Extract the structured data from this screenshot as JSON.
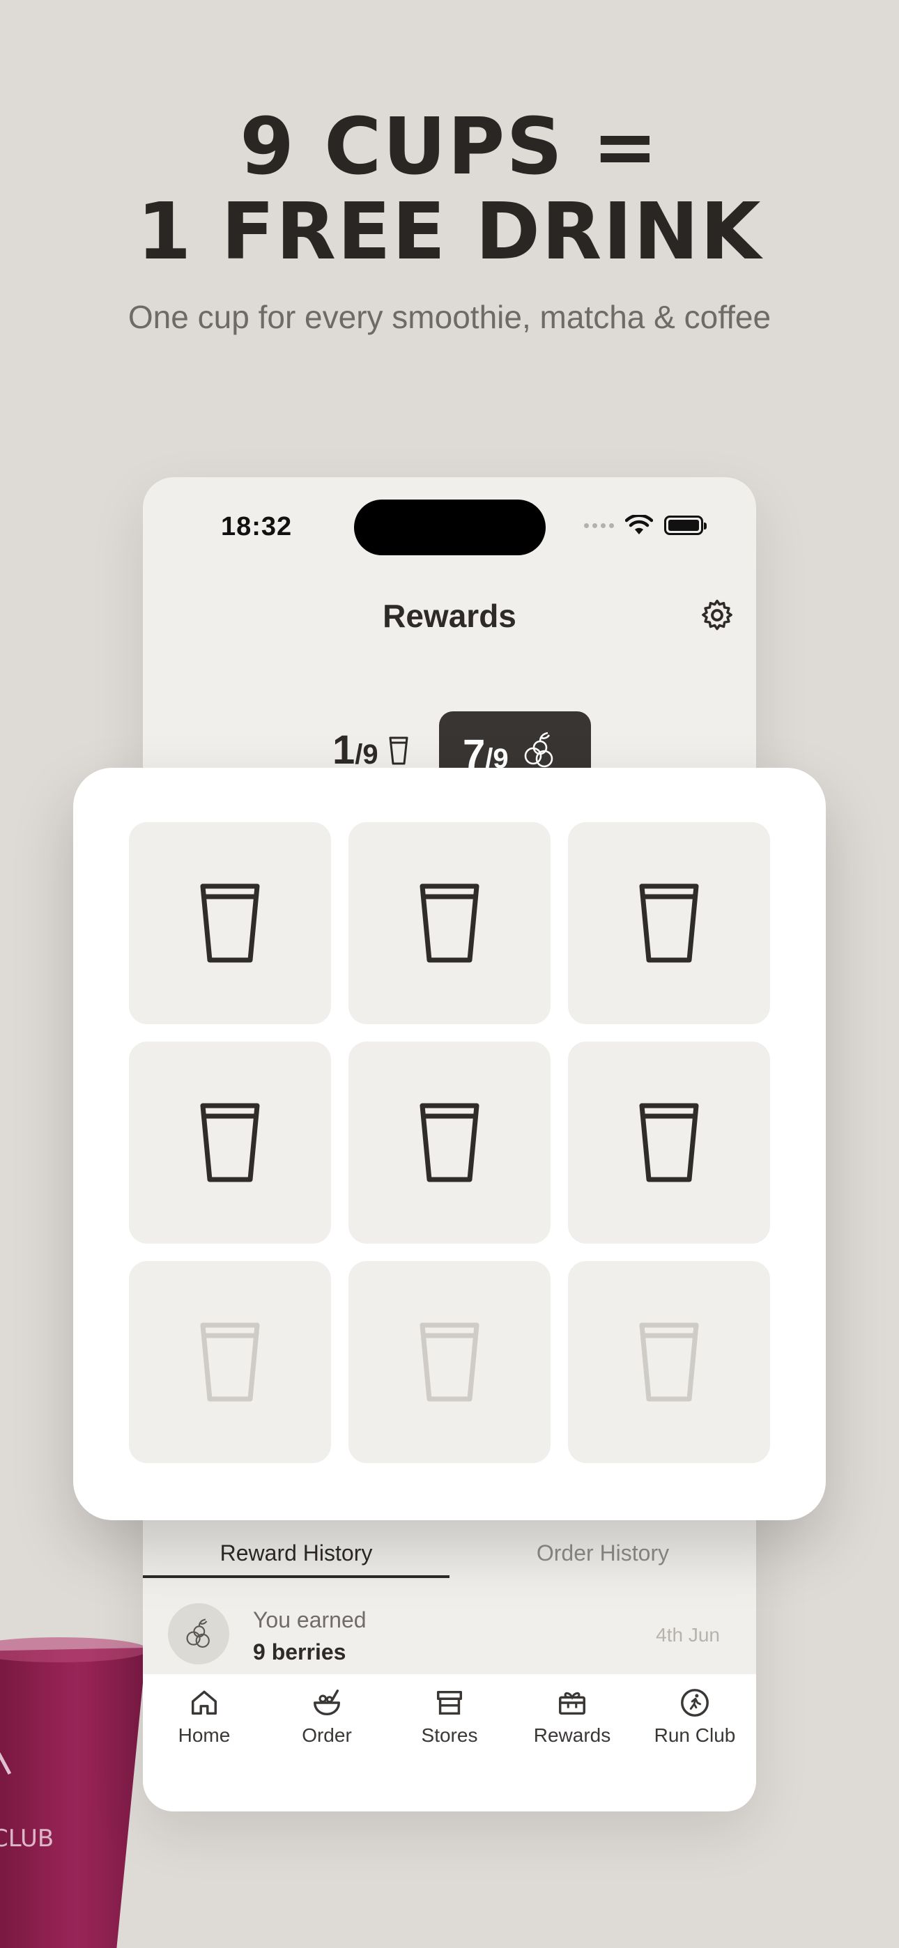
{
  "promo": {
    "headline_line1": "9 CUPS =",
    "headline_line2": "1 FREE DRINK",
    "subheadline": "One cup for every smoothie, matcha & coffee"
  },
  "status_bar": {
    "time": "18:32"
  },
  "nav": {
    "title": "Rewards",
    "settings_icon": "gear-icon"
  },
  "counters": {
    "cups": {
      "count": "1",
      "total": "/9",
      "icon": "cup-icon"
    },
    "berries": {
      "count": "7",
      "total": "/9",
      "icon": "berries-icon"
    }
  },
  "stamp_card": {
    "total": 9,
    "filled": 6,
    "cells": [
      "filled",
      "filled",
      "filled",
      "filled",
      "filled",
      "filled",
      "empty",
      "empty",
      "empty"
    ]
  },
  "history_tabs": {
    "active": "Reward History",
    "inactive": "Order History"
  },
  "history": [
    {
      "label": "You earned",
      "value": "9 berries",
      "date": "4th Jun",
      "icon": "berries-icon"
    }
  ],
  "tabbar": [
    {
      "label": "Home",
      "icon": "home-icon"
    },
    {
      "label": "Order",
      "icon": "bowl-icon"
    },
    {
      "label": "Stores",
      "icon": "store-icon"
    },
    {
      "label": "Rewards",
      "icon": "gift-icon"
    },
    {
      "label": "Run Club",
      "icon": "runner-icon"
    }
  ],
  "colors": {
    "background": "#dedad6",
    "card": "#ffffff",
    "cell": "#f1efeb",
    "cup_filled": "#2f2c2a",
    "cup_empty": "#cfcbc6",
    "dark_badge": "#383533",
    "smoothie": "#8a1d4b"
  }
}
